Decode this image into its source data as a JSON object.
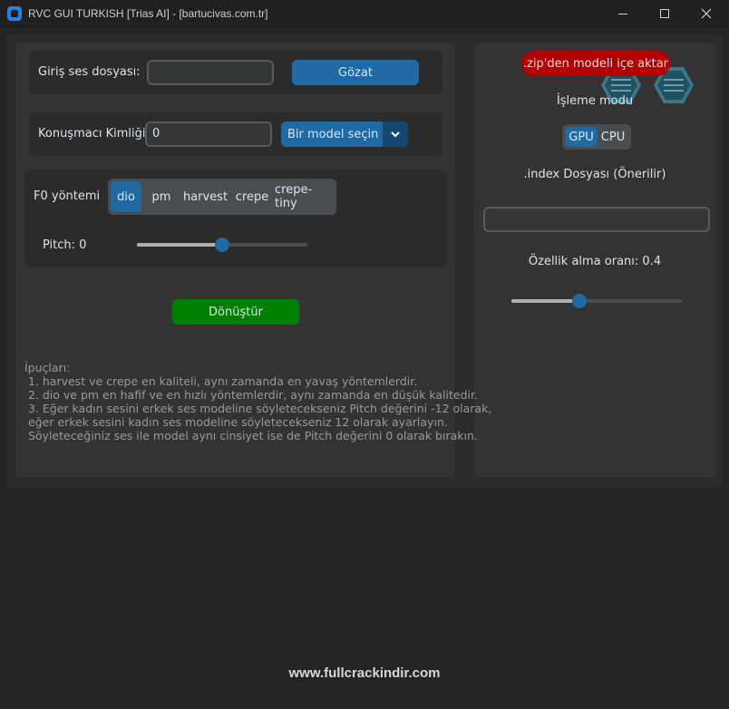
{
  "window": {
    "title": "RVC GUI TURKISH [Trias AI] - [bartucivas.com.tr]"
  },
  "left": {
    "input_label": "Giriş ses dosyası:",
    "input_value": "",
    "browse_label": "Gözat",
    "speaker_label": "Konuşmacı Kimliği:",
    "speaker_value": "0",
    "model_select_value": "Bir model seçin",
    "f0_label": "F0 yöntemi",
    "f0_options": [
      "dio",
      "pm",
      "harvest",
      "crepe",
      "crepe-tiny"
    ],
    "f0_selected": "dio",
    "pitch_label": "Pitch: 0",
    "pitch_value": 0,
    "pitch_range": [
      -12,
      12
    ],
    "convert_label": "Dönüştür",
    "tips_title": "İpuçları:",
    "tips": [
      " 1. harvest ve crepe en kaliteli, aynı zamanda en yavaş yöntemlerdir.",
      "",
      " 2. dio ve pm en hafif ve en hızlı yöntemlerdir, aynı zamanda en düşük kalitedir.",
      "",
      " 3. Eğer kadın sesini erkek ses modeline söyletecekseniz Pitch değerini -12 olarak,",
      " eğer erkek sesini kadın ses modeline söyletecekseniz 12 olarak ayarlayın.",
      " Söyleteceğiniz ses ile model aynı cinsiyet ise de Pitch değerini 0 olarak bırakın."
    ]
  },
  "right": {
    "import_label": ".zip'den modeli içe aktar",
    "mode_label": "İşleme modu",
    "mode_options": [
      "GPU",
      "CPU"
    ],
    "mode_selected": "GPU",
    "index_label": ".index Dosyası (Önerilir)",
    "index_value": "",
    "feature_label": "Özellik alma oranı: 0.4",
    "feature_value": 0.4
  },
  "watermark": "www.fullcrackindir.com",
  "colors": {
    "accent": "#1f6aa5",
    "convert": "#008000",
    "import": "#b00000"
  },
  "icons": {
    "app": "app-icon",
    "minimize": "minimize-icon",
    "maximize": "maximize-icon",
    "close": "close-icon",
    "dropdown": "chevron-down-icon"
  }
}
